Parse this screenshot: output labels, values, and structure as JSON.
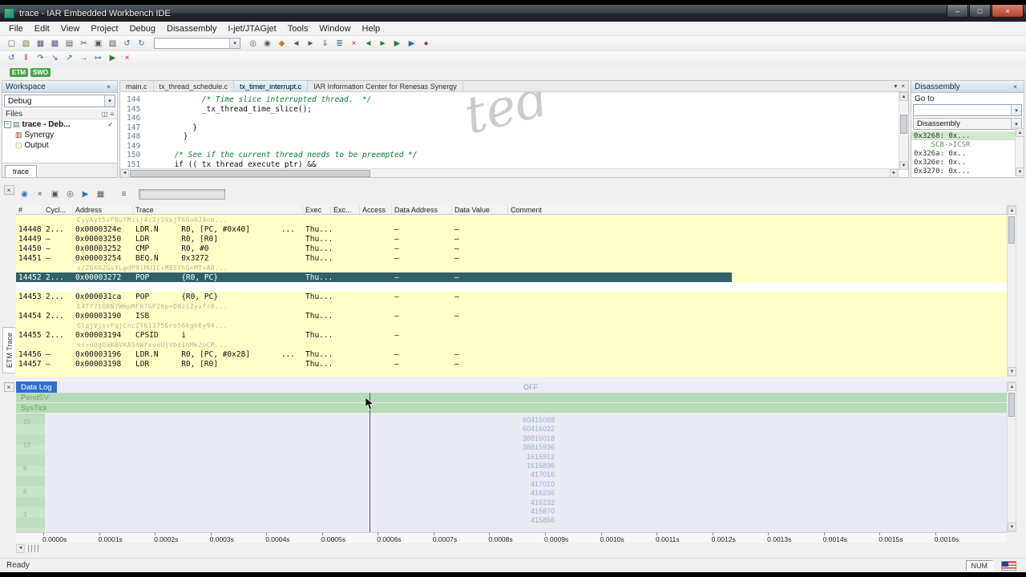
{
  "ui": {
    "close": "×",
    "dropdown": "▾",
    "up": "▲",
    "down": "▼",
    "left": "◄",
    "right": "►",
    "check": "✓",
    "collapse": "−",
    "grid": "◫",
    "list": "≡",
    "minimize": "–",
    "maximize": "□"
  },
  "window": {
    "title": "trace - IAR Embedded Workbench IDE"
  },
  "menu": {
    "items": [
      "File",
      "Edit",
      "View",
      "Project",
      "Debug",
      "Disassembly",
      "I-jet/JTAGjet",
      "Tools",
      "Window",
      "Help"
    ]
  },
  "toolbar_main": {
    "icons": [
      {
        "name": "new-file-icon",
        "glyph": "▢",
        "color": "#5a5a5a"
      },
      {
        "name": "open-file-icon",
        "glyph": "▧",
        "color": "#8a7340"
      },
      {
        "name": "save-icon",
        "glyph": "▦",
        "color": "#44607c"
      },
      {
        "name": "save-all-icon",
        "glyph": "▩",
        "color": "#44607c"
      },
      {
        "name": "print-icon",
        "glyph": "▤",
        "color": "#5a5a5a"
      },
      {
        "name": "cut-icon",
        "glyph": "✂",
        "color": "#5a5a5a"
      },
      {
        "name": "copy-icon",
        "glyph": "▣",
        "color": "#5a5a5a"
      },
      {
        "name": "paste-icon",
        "glyph": "▨",
        "color": "#5a5a5a"
      },
      {
        "name": "undo-icon",
        "glyph": "↺",
        "color": "#3c6aa0"
      },
      {
        "name": "redo-icon",
        "glyph": "↻",
        "color": "#3c6aa0"
      },
      {
        "name": "find-icon",
        "glyph": "◎",
        "color": "#5a5a5a"
      },
      {
        "name": "find-next-icon",
        "glyph": "◉",
        "color": "#5a5a5a"
      },
      {
        "name": "bookmark-icon",
        "glyph": "◆",
        "color": "#c08020"
      },
      {
        "name": "prev-bookmark-icon",
        "glyph": "◄",
        "color": "#5a5a5a"
      },
      {
        "name": "next-bookmark-icon",
        "glyph": "►",
        "color": "#5a5a5a"
      },
      {
        "name": "make-icon",
        "glyph": "⇓",
        "color": "#3c6aa0"
      },
      {
        "name": "compile-icon",
        "glyph": "≣",
        "color": "#3c6aa0"
      },
      {
        "name": "stop-build-icon",
        "glyph": "×",
        "color": "#b03030"
      },
      {
        "name": "nav-back-icon",
        "glyph": "◄",
        "color": "#2f7d2f"
      },
      {
        "name": "nav-forward-icon",
        "glyph": "►",
        "color": "#2f7d2f"
      },
      {
        "name": "download-debug-icon",
        "glyph": "▶",
        "color": "#2f7d2f"
      },
      {
        "name": "debug-without-download-icon",
        "glyph": "▶",
        "color": "#3c6aa0"
      },
      {
        "name": "break-all-icon",
        "glyph": "●",
        "color": "#c03030"
      }
    ]
  },
  "toolbar_debug": {
    "icons": [
      {
        "name": "reset-icon",
        "glyph": "↺",
        "color": "#3c6aa0"
      },
      {
        "name": "break-icon",
        "glyph": "‖",
        "color": "#b04040"
      },
      {
        "name": "step-over-icon",
        "glyph": "↷",
        "color": "#3c6aa0"
      },
      {
        "name": "step-into-icon",
        "glyph": "↘",
        "color": "#3c6aa0"
      },
      {
        "name": "step-out-icon",
        "glyph": "↗",
        "color": "#3c6aa0"
      },
      {
        "name": "next-statement-icon",
        "glyph": "→",
        "color": "#3c6aa0"
      },
      {
        "name": "run-to-cursor-icon",
        "glyph": "↦",
        "color": "#3c6aa0"
      },
      {
        "name": "go-icon",
        "glyph": "▶",
        "color": "#2f7d2f"
      },
      {
        "name": "stop-debug-icon",
        "glyph": "×",
        "color": "#c22020"
      }
    ]
  },
  "trace_badges": [
    {
      "label": "ETM",
      "color": "#4aa34a"
    },
    {
      "label": "SWO",
      "color": "#4aa34a"
    }
  ],
  "workspace": {
    "title": "Workspace",
    "config_selector": "Debug",
    "files_header": "Files",
    "tree": [
      {
        "label": "trace - Deb...",
        "level": 0,
        "bold": true,
        "icon": "project-icon",
        "glyph": "▤",
        "color": "#3c6aa0",
        "check": "✓"
      },
      {
        "label": "Synergy",
        "level": 1,
        "icon": "group-icon",
        "glyph": "▥",
        "color": "#a03030"
      },
      {
        "label": "Output",
        "level": 1,
        "icon": "folder-icon",
        "glyph": "▢",
        "color": "#c09020"
      }
    ],
    "bottom_tab": "trace"
  },
  "editor": {
    "tabs": [
      {
        "label": "main.c",
        "active": false
      },
      {
        "label": "tx_thread_schedule.c",
        "active": false
      },
      {
        "label": "tx_timer_interrupt.c",
        "active": true
      },
      {
        "label": "IAR Information Center for Renesas Synergy",
        "active": false
      }
    ],
    "watermark": "ted",
    "lines": [
      {
        "num": "144",
        "indent": 8,
        "text": "/* Time slice interrupted thread.  */",
        "kind": "comment"
      },
      {
        "num": "145",
        "indent": 8,
        "text": "_tx_thread_time_slice();",
        "kind": "code"
      },
      {
        "num": "146",
        "indent": 0,
        "text": "",
        "kind": "code"
      },
      {
        "num": "147",
        "indent": 6,
        "text": "}",
        "kind": "code"
      },
      {
        "num": "148",
        "indent": 4,
        "text": "}",
        "kind": "code"
      },
      {
        "num": "149",
        "indent": 0,
        "text": "",
        "kind": "code"
      },
      {
        "num": "150",
        "indent": 2,
        "text": "/* See if the current thread needs to be preempted */",
        "kind": "comment"
      },
      {
        "num": "151",
        "indent": 2,
        "text": "if ((_tx_thread_execute_ptr) &&",
        "kind": "code"
      }
    ]
  },
  "disassembly": {
    "title": "Disassembly",
    "goto_label": "Go to",
    "zone": "Disassembly",
    "rows": [
      {
        "text": "0x3268: 0x...",
        "highlight": true,
        "indent": 0
      },
      {
        "text": "SCB->ICSR",
        "dim": true,
        "indent": 1
      },
      {
        "text": "0x326a: 0x..",
        "indent": 0
      },
      {
        "text": "0x326e: 0x..",
        "indent": 0
      },
      {
        "text": "0x3270: 0x...",
        "indent": 0
      }
    ]
  },
  "trace": {
    "side_tab": "ETM Trace",
    "toolbar_icons": [
      {
        "name": "trace-enable-icon",
        "glyph": "◉",
        "color": "#2e6fc0"
      },
      {
        "name": "trace-clear-icon",
        "glyph": "×",
        "color": "#555555"
      },
      {
        "name": "trace-copy-icon",
        "glyph": "▣",
        "color": "#555555"
      },
      {
        "name": "trace-find-icon",
        "glyph": "◎",
        "color": "#555555"
      },
      {
        "name": "trace-browse-icon",
        "glyph": "▶",
        "color": "#2e6fc0"
      },
      {
        "name": "trace-save-icon",
        "glyph": "▦",
        "color": "#555555"
      },
      {
        "name": "trace-columns-icon",
        "glyph": "≡",
        "color": "#555555"
      }
    ],
    "columns": [
      "#",
      "Cycl...",
      "Address",
      "Trace",
      "Exec",
      "Exc...",
      "Access",
      "Data Address",
      "Data Value",
      "Comment"
    ],
    "rows": [
      {
        "type": "wm",
        "text": "CyyAyt5vFNuYMzij4cIj1VajT66oOJAnb..."
      },
      {
        "type": "row",
        "id": "14448",
        "cyc": "2...",
        "addr": "0x0000324e",
        "trace": "LDR.N     R0, [PC, #0x40]",
        "tail": "...",
        "exec": "Thu...",
        "da": "–",
        "dv": "–"
      },
      {
        "type": "row",
        "id": "14449",
        "cyc": "–",
        "addr": "0x00003250",
        "trace": "LDR       R0, [R0]",
        "exec": "Thu...",
        "da": "–",
        "dv": "–"
      },
      {
        "type": "row",
        "id": "14450",
        "cyc": "–",
        "addr": "0x00003252",
        "trace": "CMP       R0, #0",
        "exec": "Thu...",
        "da": "–",
        "dv": "–"
      },
      {
        "type": "row",
        "id": "14451",
        "cyc": "–",
        "addr": "0x00003254",
        "trace": "BEQ.N     0x3272",
        "exec": "Thu...",
        "da": "–",
        "dv": "–"
      },
      {
        "type": "wm",
        "text": "s/Z6XO2GsXLgdP91HUIC+M85YhG+MT+A0..."
      },
      {
        "type": "row",
        "selected": true,
        "id": "14452",
        "cyc": "2...",
        "addr": "0x00003272",
        "trace": "POP       {R0, PC}",
        "exec": "Thu...",
        "da": "–",
        "dv": "–"
      },
      {
        "type": "empty"
      },
      {
        "type": "row",
        "id": "14453",
        "cyc": "2...",
        "addr": "0x000031ca",
        "trace": "POP       {R0, PC}",
        "exec": "Thu...",
        "da": "–",
        "dv": "–"
      },
      {
        "type": "wm",
        "text": "E4Tf7tORNYWmpMFH7GP26p+D0ziZyxfr8..."
      },
      {
        "type": "row",
        "id": "14454",
        "cyc": "2...",
        "addr": "0x00003190",
        "trace": "ISB",
        "exec": "Thu...",
        "da": "–",
        "dv": "–"
      },
      {
        "type": "wm",
        "text": "GlqjVjsvFqjCncZY61375GroS6kgh6y94..."
      },
      {
        "type": "row",
        "id": "14455",
        "cyc": "2...",
        "addr": "0x00003194",
        "trace": "CPSID     i",
        "exec": "Thu...",
        "da": "–",
        "dv": ""
      },
      {
        "type": "wm",
        "text": "ns+uQgQaKBVKA5nWfxooUjVbzIhMk2oCM..."
      },
      {
        "type": "row",
        "id": "14456",
        "cyc": "–",
        "addr": "0x00003196",
        "trace": "LDR.N     R0, [PC, #0x28]",
        "tail": "...",
        "exec": "Thu...",
        "da": "–",
        "dv": "–"
      },
      {
        "type": "row",
        "id": "14457",
        "cyc": "–",
        "addr": "0x00003198",
        "trace": "LDR       R0, [R0]",
        "exec": "Thu...",
        "da": "–",
        "dv": "–"
      },
      {
        "type": "partial"
      }
    ]
  },
  "datalog": {
    "tab": "Data Log",
    "off_label": "OFF",
    "channels": [
      "PendSV",
      "SysTick"
    ],
    "scale_labels": [
      "15",
      "12",
      "9",
      "6",
      "3"
    ],
    "values": [
      "60416088",
      "60416022",
      "38816018",
      "38815936",
      "1615912",
      "1615896",
      "417016",
      "417010",
      "416296",
      "416232",
      "415870",
      "415856"
    ],
    "ticks": [
      "0.0000s",
      "0.0001s",
      "0.0002s",
      "0.0003s",
      "0.0004s",
      "0.0005s",
      "0.0006s",
      "0.0007s",
      "0.0008s",
      "0.0009s",
      "0.0010s",
      "0.0011s",
      "0.0012s",
      "0.0013s",
      "0.0014s",
      "0.0015s",
      "0.0016s"
    ]
  },
  "statusbar": {
    "message": "Ready",
    "num": "NUM"
  }
}
